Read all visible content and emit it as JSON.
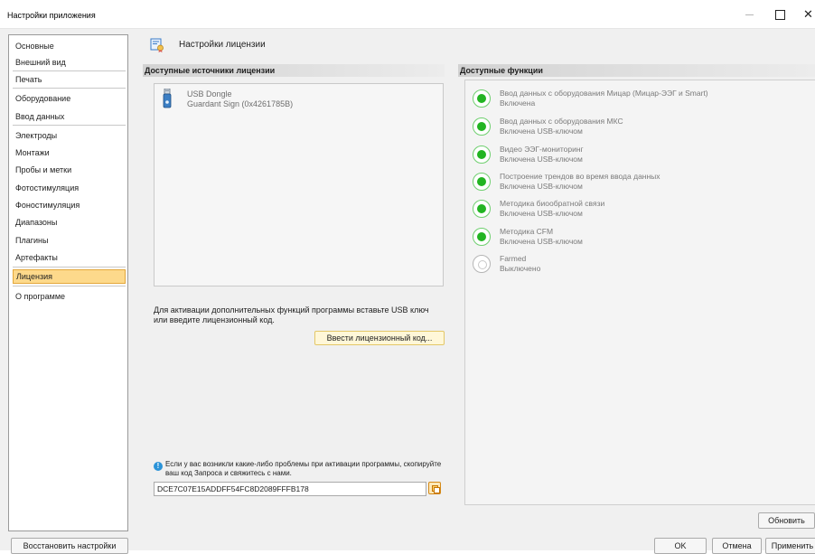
{
  "window": {
    "title": "Настройки приложения",
    "close_glyph": "✕"
  },
  "sidebar": {
    "items": [
      {
        "label": "Основные"
      },
      {
        "label": "Внешний вид"
      },
      {
        "label": "Печать"
      },
      {
        "label": "Оборудование"
      },
      {
        "label": "Ввод данных"
      },
      {
        "label": "Электроды"
      },
      {
        "label": "Монтажи"
      },
      {
        "label": "Пробы и метки"
      },
      {
        "label": "Фотостимуляция"
      },
      {
        "label": "Фоностимуляция"
      },
      {
        "label": "Диапазоны"
      },
      {
        "label": "Плагины"
      },
      {
        "label": "Артефакты"
      },
      {
        "label": "Лицензия",
        "active": true
      },
      {
        "label": "О программе"
      }
    ],
    "restore_label": "Восстановить настройки"
  },
  "header": {
    "title": "Настройки лицензии",
    "icon": "license-certificate-icon"
  },
  "sources": {
    "title": "Доступные источники лицензии",
    "items": [
      {
        "name": "USB Dongle",
        "detail": "Guardant Sign (0x4261785B)",
        "icon": "usb-dongle-icon"
      }
    ]
  },
  "activation": {
    "text": "Для активации дополнительных функций программы вставьте USB ключ или введите лицензионный код.",
    "button_label": "Ввести лицензионный код..."
  },
  "help": {
    "text": "Если у вас возникли какие-либо проблемы при активации программы, скопируйте ваш код Запроса и свяжитесь с нами.",
    "request_code": "DCE7C07E15ADDFF54FC8D2089FFFB178",
    "info_glyph": "!"
  },
  "features": {
    "title": "Доступные функции",
    "items": [
      {
        "name": "Ввод данных с оборудования Мицар (Мицар-ЭЭГ и Smart)",
        "status": "Включена",
        "enabled": true
      },
      {
        "name": "Ввод данных с оборудования МКС",
        "status": "Включена USB-ключом",
        "enabled": true
      },
      {
        "name": "Видео ЭЭГ-мониторинг",
        "status": "Включена USB-ключом",
        "enabled": true
      },
      {
        "name": "Построение трендов во время ввода данных",
        "status": "Включена USB-ключом",
        "enabled": true
      },
      {
        "name": "Методика биообратной связи",
        "status": "Включена USB-ключом",
        "enabled": true
      },
      {
        "name": "Методика CFM",
        "status": "Включена USB-ключом",
        "enabled": true
      },
      {
        "name": "Farmed",
        "status": "Выключено",
        "enabled": false
      }
    ],
    "refresh_label": "Обновить"
  },
  "footer": {
    "ok_label": "OK",
    "cancel_label": "Отмена",
    "apply_label": "Применить"
  },
  "colors": {
    "active_item_bg": "#fdd98b",
    "enabled_green": "#22b422",
    "info_blue": "#2b93d8"
  }
}
